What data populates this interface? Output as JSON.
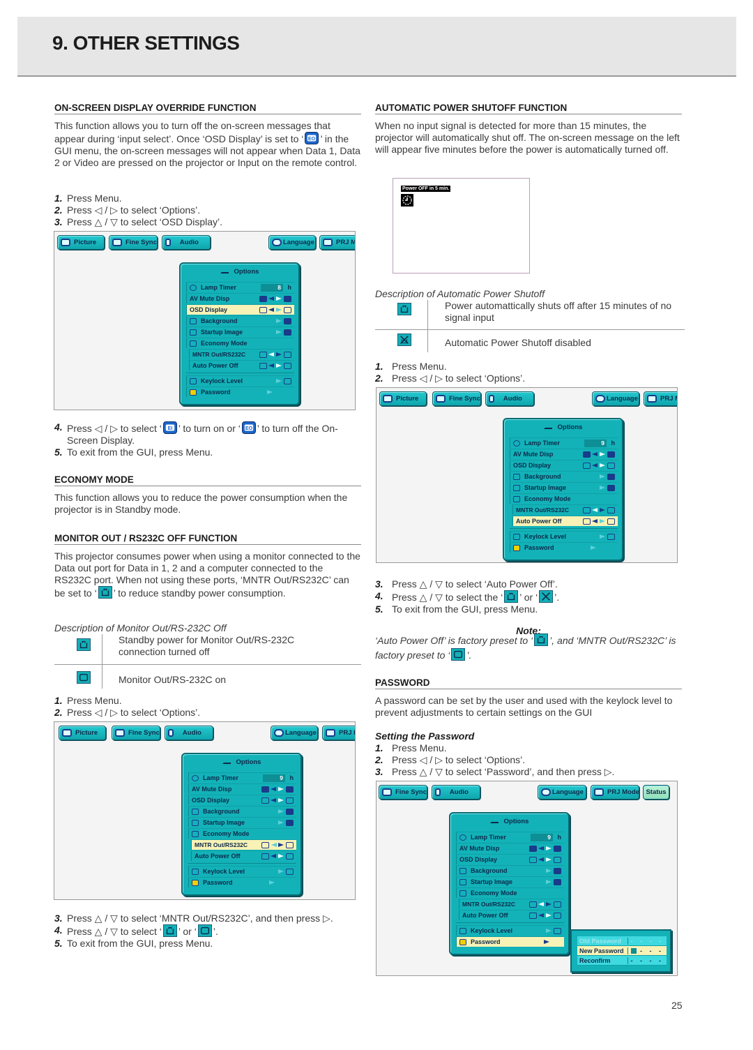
{
  "header": {
    "title": "9. OTHER SETTINGS"
  },
  "page_number": "25",
  "osd": {
    "title": "ON-SCREEN DISPLAY OVERRIDE FUNCTION",
    "body_1": "This function allows you to turn off the on-screen messages that appear during ‘input select’. Once ‘OSD Display’ is set to",
    "body_2": "’ in the GUI menu, the on-screen messages will not appear when Data 1, Data 2 or Video are pressed on the projector or Input on the remote control.",
    "steps_a": [
      {
        "num": "1.",
        "text": "Press Menu."
      },
      {
        "num": "2.",
        "text": "Press ◁ / ▷ to select ‘Options’."
      },
      {
        "num": "3.",
        "text": "Press △ / ▽ to select ‘OSD Display’."
      }
    ],
    "step4_a": "Press ◁ / ▷ to select ‘",
    "step4_b": "’ to turn on or ‘",
    "step4_c": "’ to turn off the On-Screen Display.",
    "step4_num": "4.",
    "step5": {
      "num": "5.",
      "text": "To exit from the GUI, press Menu."
    }
  },
  "economy": {
    "title": "ECONOMY MODE",
    "body": "This function allows you to reduce the power consumption when the projector is in Standby mode."
  },
  "monitor": {
    "title": "MONITOR OUT / RS232C OFF FUNCTION",
    "body_1": "This projector consumes power when using a monitor connected to the Data out port for Data in 1, 2 and a computer connected to the RS232C port. When not using these ports, ‘MNTR Out/RS232C’ can be set to ‘",
    "body_2": "’ to reduce standby power consumption.",
    "desc_title": "Description of Monitor Out/RS-232C Off",
    "desc_rows": [
      {
        "icon": "standby-off-icon",
        "text": "Standby power for Monitor Out/RS-232C connection turned off"
      },
      {
        "icon": "monitor-on-icon",
        "text": "Monitor Out/RS-232C on"
      }
    ],
    "steps_a": [
      {
        "num": "1.",
        "text": "Press Menu."
      },
      {
        "num": "2.",
        "text": "Press ◁ / ▷ to select ‘Options’."
      }
    ],
    "step3": {
      "num": "3.",
      "text": "Press △ / ▽ to select ‘MNTR Out/RS232C’, and then press ▷."
    },
    "step4_num": "4.",
    "step4_a": "Press △ / ▽ to select ‘",
    "step4_b": "’ or ‘",
    "step4_c": "’.",
    "step5": {
      "num": "5.",
      "text": "To exit from the GUI, press Menu."
    }
  },
  "autopower": {
    "title": "AUTOMATIC POWER SHUTOFF FUNCTION",
    "body": "When no input signal is detected for more than 15 minutes, the projector will automatically shut off. The on-screen message on the left will appear five minutes before the power is automatically turned off.",
    "screen_message": "Power OFF in 5 min.",
    "desc_title": "Description of Automatic Power Shutoff",
    "desc_rows": [
      {
        "icon": "standby-off-icon",
        "text": "Power automattically shuts off after 15 minutes of no signal input"
      },
      {
        "icon": "shutoff-disabled-icon",
        "text": "Automatic Power Shutoff disabled"
      }
    ],
    "steps_a": [
      {
        "num": "1.",
        "text": "Press Menu."
      },
      {
        "num": "2.",
        "text": "Press ◁ / ▷ to select ‘Options’."
      }
    ],
    "step3": {
      "num": "3.",
      "text": "Press △ / ▽ to select ‘Auto Power Off’."
    },
    "step4_num": "4.",
    "step4_a": "Press △ / ▽ to select the ‘",
    "step4_b": "’ or ‘",
    "step4_c": "’.",
    "step5": {
      "num": "5.",
      "text": "To exit from the GUI, press Menu."
    },
    "note_title": "Note:",
    "note_1": "‘Auto Power Off’ is factory preset to ‘",
    "note_2": "’, and ‘MNTR Out/RS232C’ is factory preset to ‘",
    "note_3": "’."
  },
  "password": {
    "title": "PASSWORD",
    "body": "A password can be set by the user and used with the keylock level to prevent adjustments to certain settings on the GUI",
    "subtitle": "Setting the Password",
    "steps": [
      {
        "num": "1.",
        "text": "Press Menu."
      },
      {
        "num": "2.",
        "text": "Press ◁ / ▷ to select ‘Options’."
      },
      {
        "num": "3.",
        "text": "Press △ / ▽ to select ‘Password’, and then press ▷."
      }
    ],
    "dialog": {
      "rows": [
        {
          "label": "Old Password",
          "value": "- - - -"
        },
        {
          "label": "New Password",
          "value": "- - -"
        },
        {
          "label": "Reconfirm",
          "value": "- - - -"
        }
      ]
    }
  },
  "gui": {
    "tabs_a": [
      "Picture",
      "Fine Sync",
      "Audio",
      "Language",
      "PRJ M"
    ],
    "tabs_b": [
      "Fine Sync",
      "Audio",
      "Language",
      "PRJ Mode",
      "Status"
    ],
    "menu_title": "Options",
    "menu": {
      "lamp_timer": "Lamp Timer",
      "av_mute": "AV Mute Disp",
      "osd_display": "OSD Display",
      "background": "Background",
      "startup": "Startup Image",
      "economy": "Economy Mode",
      "mntr": "MNTR Out/RS232C",
      "auto_power": "Auto Power Off",
      "keylock": "Keylock Level",
      "password": "Password",
      "unit": "h"
    },
    "lamp_values": [
      "8",
      "9",
      "9",
      "9"
    ]
  }
}
